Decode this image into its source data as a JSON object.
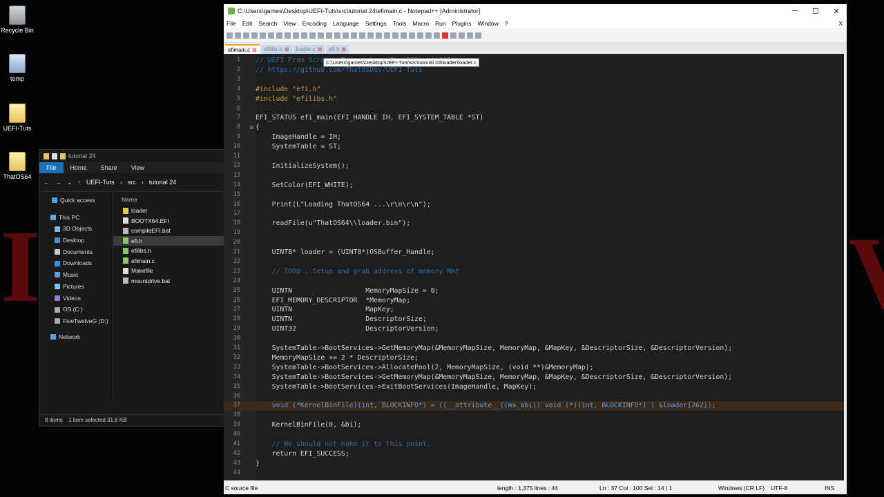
{
  "desktop": {
    "icons": [
      {
        "label": "Recycle Bin"
      },
      {
        "label": "temp"
      },
      {
        "label": "UEFI-Tuts"
      },
      {
        "label": "ThatOS64"
      }
    ]
  },
  "explorer": {
    "title": "tutorial 24",
    "ribbon_tabs": [
      "File",
      "Home",
      "Share",
      "View"
    ],
    "breadcrumb": [
      "UEFI-Tuts",
      "src",
      "tutorial 24"
    ],
    "nav_items": [
      "Quick access",
      "This PC",
      "3D Objects",
      "Desktop",
      "Documents",
      "Downloads",
      "Music",
      "Pictures",
      "Videos",
      "OS (C:)",
      "FiveTwelveG (D:)",
      "Network"
    ],
    "column_header": "Name",
    "files": [
      "loader",
      "BOOTX64.EFI",
      "compileEFI.bat",
      "efi.h",
      "efilibs.h",
      "efimain.c",
      "Makefile",
      "mountdrive.bat"
    ],
    "status": {
      "count": "8 items",
      "selected": "1 item selected  31.6 KB"
    }
  },
  "npp": {
    "title": "C:\\Users\\games\\Desktop\\UEFI-Tuts\\src\\tutorial 24\\efimain.c - Notepad++ [Administrator]",
    "menu": [
      "File",
      "Edit",
      "Search",
      "View",
      "Encoding",
      "Language",
      "Settings",
      "Tools",
      "Macro",
      "Run",
      "Plugins",
      "Window",
      "?"
    ],
    "window_close": "X",
    "tabs": [
      "efimain.c",
      "efilibs.h",
      "loader.c",
      "efi.h"
    ],
    "tooltip": "C:\\Users\\games\\Desktop\\UEFI-Tuts\\src\\tutorial 24\\loader\\loader.c",
    "code_lines": [
      "// UEFI From Scratch Tutorials - ThatOSDev ( 2021 )",
      "// https://github.com/ThatOSDev/UEFI-Tuts",
      "",
      "#include \"efi.h\"",
      "#include \"efilibs.h\"",
      "",
      "EFI_STATUS efi_main(EFI_HANDLE IH, EFI_SYSTEM_TABLE *ST)",
      "{",
      "    ImageHandle = IH;",
      "    SystemTable = ST;",
      "",
      "    InitializeSystem();",
      "",
      "    SetColor(EFI_WHITE);",
      "",
      "    Print(L\"Loading ThatOS64 ...\\r\\n\\r\\n\");",
      "",
      "    readFile(u\"ThatOS64\\\\loader.bin\");",
      "",
      "",
      "    UINT8* loader = (UINT8*)OSBuffer_Handle;",
      "",
      "    // TODO : Setup and grab address of memory MAP",
      "",
      "    UINTN                  MemoryMapSize = 0;",
      "    EFI_MEMORY_DESCRIPTOR  *MemoryMap;",
      "    UINTN                  MapKey;",
      "    UINTN                  DescriptorSize;",
      "    UINT32                 DescriptorVersion;",
      "",
      "    SystemTable->BootServices->GetMemoryMap(&MemoryMapSize, MemoryMap, &MapKey, &DescriptorSize, &DescriptorVersion);",
      "    MemoryMapSize += 2 * DescriptorSize;",
      "    SystemTable->BootServices->AllocatePool(2, MemoryMapSize, (void **)&MemoryMap);",
      "    SystemTable->BootServices->GetMemoryMap(&MemoryMapSize, MemoryMap, &MapKey, &DescriptorSize, &DescriptorVersion);",
      "    SystemTable->BootServices->ExitBootServices(ImageHandle, MapKey);",
      "",
      "    void (*KernelBinFile)(int, BLOCKINFO*) = ((__attribute__((ms_abi)) void (*)(int, BLOCKINFO*) ) &loader[262]);",
      "",
      "    KernelBinFile(0, &bi);",
      "",
      "    // We should not make it to this point.",
      "    return EFI_SUCCESS;",
      "}",
      ""
    ],
    "current_line": 37,
    "status": {
      "type": "C source file",
      "length": "length : 1,375   lines : 44",
      "pos": "Ln : 37   Col : 100   Sel : 14 | 1",
      "eol": "Windows (CR LF)",
      "enc": "UTF-8",
      "mode": "INS"
    }
  }
}
